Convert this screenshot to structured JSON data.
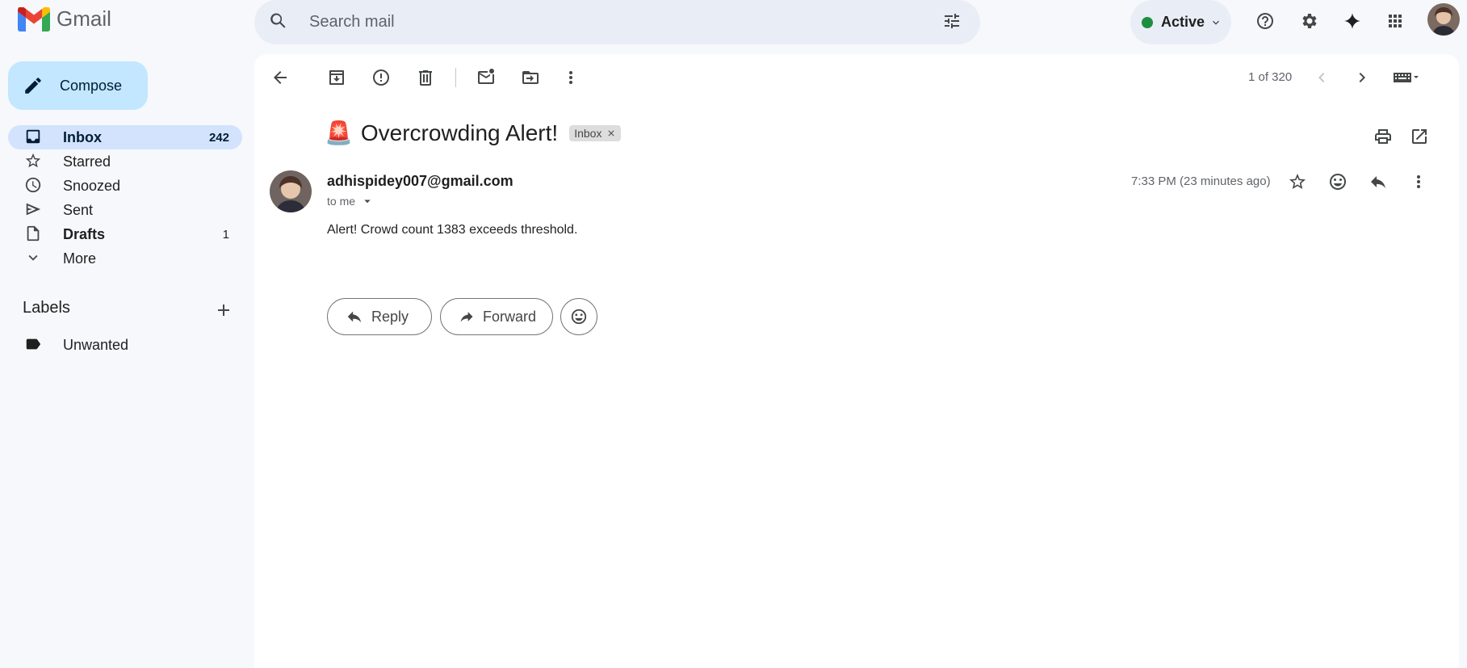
{
  "header": {
    "app_name": "Gmail",
    "search_placeholder": "Search mail",
    "status": "Active",
    "colors": {
      "status": "#1e8e3e",
      "search_bg": "#e9eef6"
    }
  },
  "sidebar": {
    "compose_label": "Compose",
    "items": [
      {
        "label": "Inbox",
        "count": "242",
        "icon": "inbox-icon"
      },
      {
        "label": "Starred",
        "count": "",
        "icon": "star-icon"
      },
      {
        "label": "Snoozed",
        "count": "",
        "icon": "clock-icon"
      },
      {
        "label": "Sent",
        "count": "",
        "icon": "send-icon"
      },
      {
        "label": "Drafts",
        "count": "1",
        "icon": "draft-icon"
      },
      {
        "label": "More",
        "count": "",
        "icon": "chevron-down-icon"
      }
    ],
    "labels_title": "Labels",
    "labels": [
      {
        "label": "Unwanted",
        "icon": "label-icon"
      }
    ]
  },
  "toolbar": {
    "pager": "1 of 320"
  },
  "email": {
    "subject_emoji": "🚨",
    "subject": "Overcrowding Alert!",
    "chip_label": "Inbox",
    "sender": "adhispidey007@gmail.com",
    "to": "to me",
    "time": "7:33 PM (23 minutes ago)",
    "body": "Alert! Crowd count 1383 exceeds threshold."
  },
  "actions": {
    "reply": "Reply",
    "forward": "Forward"
  }
}
